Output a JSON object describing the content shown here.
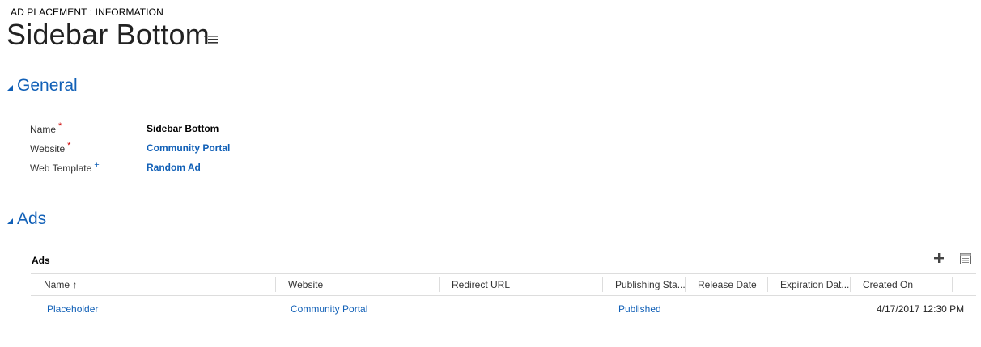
{
  "header": {
    "entity_type": "AD PLACEMENT : INFORMATION",
    "title": "Sidebar Bottom"
  },
  "sections": {
    "general": {
      "title": "General"
    },
    "ads": {
      "title": "Ads"
    }
  },
  "fields": {
    "name": {
      "label": "Name",
      "marker": "*",
      "value": "Sidebar Bottom"
    },
    "website": {
      "label": "Website",
      "marker": "*",
      "value": "Community Portal"
    },
    "web_template": {
      "label": "Web Template",
      "marker": "+",
      "value": "Random Ad"
    }
  },
  "subgrid": {
    "title": "Ads",
    "columns": {
      "name": "Name ↑",
      "website": "Website",
      "redirect_url": "Redirect URL",
      "publishing_state": "Publishing Sta...",
      "release_date": "Release Date",
      "expiration_date": "Expiration Dat...",
      "created_on": "Created On"
    },
    "rows": [
      {
        "name": "Placeholder",
        "website": "Community Portal",
        "redirect_url": "",
        "publishing_state": "Published",
        "release_date": "",
        "expiration_date": "",
        "created_on": "4/17/2017 12:30 PM"
      }
    ]
  },
  "icons": {
    "title_menu": "list-menu-icon",
    "collapse": "collapse-triangle-icon",
    "add": "plus-icon",
    "view": "grid-view-icon"
  },
  "colors": {
    "accent": "#1160b7",
    "required": "#cc0000",
    "border": "#dddddd"
  }
}
